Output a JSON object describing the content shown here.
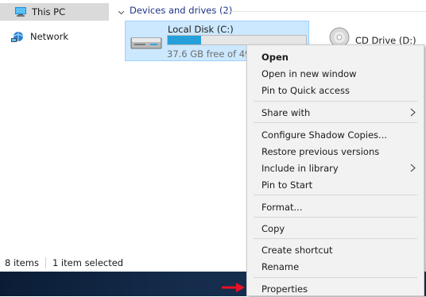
{
  "nav": {
    "items": [
      {
        "label": "This PC",
        "icon": "computer-icon",
        "selected": true
      },
      {
        "label": "Network",
        "icon": "network-icon",
        "selected": false
      }
    ]
  },
  "content": {
    "group_header": "Devices and drives (2)",
    "local_disk": {
      "name": "Local Disk (C:)",
      "free_text": "37.6 GB free of 49",
      "used_fraction": 0.24,
      "bar_color": "#26a0da"
    },
    "cd_drive": {
      "name": "CD Drive (D:)"
    }
  },
  "status": {
    "items_count": "8 items",
    "selection": "1 item selected"
  },
  "context_menu": {
    "items": [
      {
        "label": "Open",
        "bold": true
      },
      {
        "label": "Open in new window"
      },
      {
        "label": "Pin to Quick access"
      },
      {
        "label": "Share with",
        "submenu": true
      },
      {
        "label": "Configure Shadow Copies..."
      },
      {
        "label": "Restore previous versions"
      },
      {
        "label": "Include in library",
        "submenu": true
      },
      {
        "label": "Pin to Start"
      },
      {
        "label": "Format..."
      },
      {
        "label": "Copy"
      },
      {
        "label": "Create shortcut"
      },
      {
        "label": "Rename"
      },
      {
        "label": "Properties"
      }
    ]
  },
  "colors": {
    "selection_bg": "#cce8ff",
    "header_text": "#1e3287",
    "pointer_arrow": "#e81123"
  }
}
